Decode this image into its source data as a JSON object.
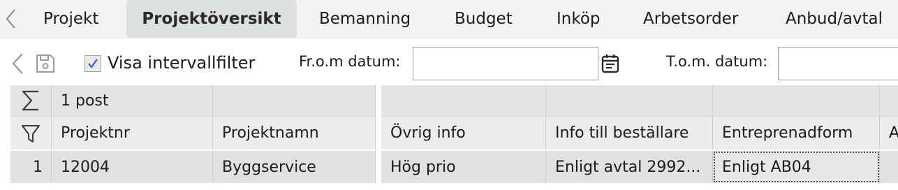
{
  "tabs": [
    {
      "label": "Projekt",
      "active": false
    },
    {
      "label": "Projektöversikt",
      "active": true
    },
    {
      "label": "Bemanning",
      "active": false
    },
    {
      "label": "Budget",
      "active": false
    },
    {
      "label": "Inköp",
      "active": false
    },
    {
      "label": "Arbetsorder",
      "active": false
    },
    {
      "label": "Anbud/avtal",
      "active": false
    }
  ],
  "toolbar": {
    "show_interval_filter_label": "Visa intervallfilter",
    "show_interval_filter_checked": true,
    "from_date_label": "Fr.o.m datum:",
    "from_date_value": "",
    "to_date_label": "T.o.m. datum:",
    "to_date_value": ""
  },
  "grid": {
    "summary_count": "1 post",
    "columns": [
      "Projektnr",
      "Projektnamn",
      "Övrig info",
      "Info till beställare",
      "Entreprenadform",
      "A"
    ],
    "rows": [
      {
        "row_number": "1",
        "projektnr": "12004",
        "projektnamn": "Byggservice",
        "ovrig_info": "Hög prio",
        "info_till_bestallare": "Enligt avtal 2992...",
        "entreprenadform": "Enligt AB04"
      }
    ]
  },
  "icons": {
    "back": "chevron-left-icon",
    "save": "save-icon",
    "calendar": "calendar-icon",
    "sum": "sigma-icon",
    "filter": "filter-icon"
  },
  "colors": {
    "active_tab_bg": "#dde2df",
    "tabbar_bg": "#f3f3f3",
    "grid_header_bg": "#ececec",
    "grid_row_bg": "#e1e1e1"
  }
}
